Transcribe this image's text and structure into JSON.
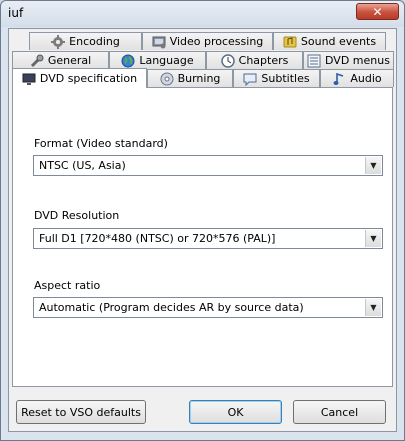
{
  "window": {
    "title": "iuf",
    "close_glyph": "✕"
  },
  "tabs_row1": [
    {
      "label": "Encoding",
      "icon": "gear-icon"
    },
    {
      "label": "Video processing",
      "icon": "video-processing-icon"
    },
    {
      "label": "Sound events",
      "icon": "sound-events-icon"
    }
  ],
  "tabs_row2": [
    {
      "label": "General",
      "icon": "general-icon"
    },
    {
      "label": "Language",
      "icon": "globe-icon"
    },
    {
      "label": "Chapters",
      "icon": "clock-icon"
    },
    {
      "label": "DVD menus",
      "icon": "menu-list-icon"
    }
  ],
  "tabs_row3": [
    {
      "label": "DVD specification",
      "icon": "monitor-icon",
      "active": true
    },
    {
      "label": "Burning",
      "icon": "disc-icon"
    },
    {
      "label": "Subtitles",
      "icon": "subtitles-icon"
    },
    {
      "label": "Audio",
      "icon": "music-note-icon"
    }
  ],
  "fields": {
    "format": {
      "label": "Format (Video standard)",
      "value": "NTSC (US, Asia)"
    },
    "resolution": {
      "label": "DVD Resolution",
      "value": "Full D1 [720*480 (NTSC) or 720*576 (PAL)]"
    },
    "aspect": {
      "label": "Aspect ratio",
      "value": "Automatic (Program decides AR by source data)"
    }
  },
  "buttons": {
    "reset": "Reset to VSO defaults",
    "ok": "OK",
    "cancel": "Cancel"
  },
  "dropdown_arrow": "▼"
}
